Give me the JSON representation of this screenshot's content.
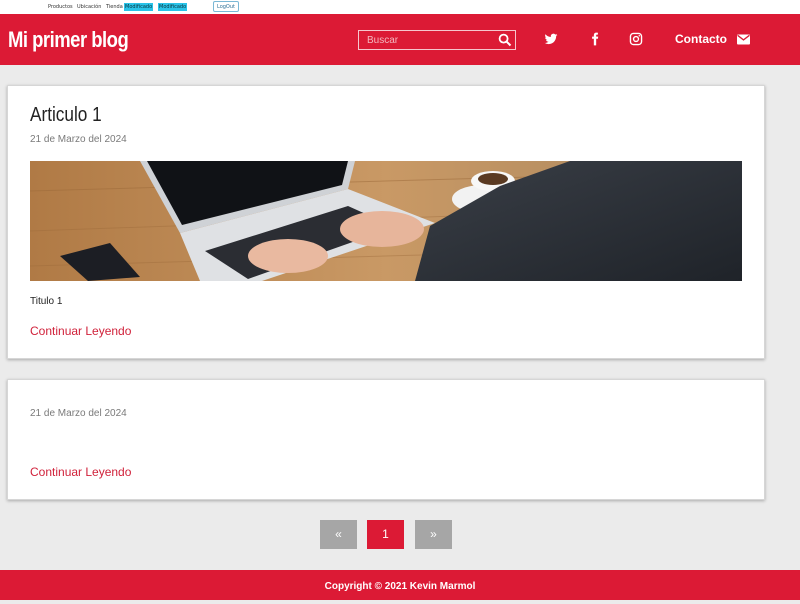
{
  "topnav": {
    "links": [
      "Productos",
      "Ubicación",
      "Tienda"
    ],
    "highlighted": [
      "Modificado",
      "Modificado"
    ],
    "logout": "LogOut"
  },
  "header": {
    "brand": "Mi primer blog",
    "search_placeholder": "Buscar",
    "social_icons": [
      "twitter-icon",
      "facebook-icon",
      "instagram-icon"
    ],
    "contact_label": "Contacto",
    "contact_icon": "envelope-icon"
  },
  "articles": [
    {
      "title": "Articulo 1",
      "date": "21 de Marzo del 2024",
      "image": "laptop-typing-photo",
      "excerpt": "Titulo 1",
      "read_more": "Continuar Leyendo"
    },
    {
      "title": "",
      "date": "21 de Marzo del 2024",
      "excerpt": "",
      "read_more": "Continuar Leyendo"
    }
  ],
  "pagination": {
    "prev": "«",
    "current": "1",
    "next": "»"
  },
  "footer": {
    "text": "Copyright © 2021 Kevin Marmol"
  },
  "colors": {
    "primary": "#dc1a35",
    "background": "#ebebeb",
    "pager_inactive": "#a6a6a6"
  }
}
